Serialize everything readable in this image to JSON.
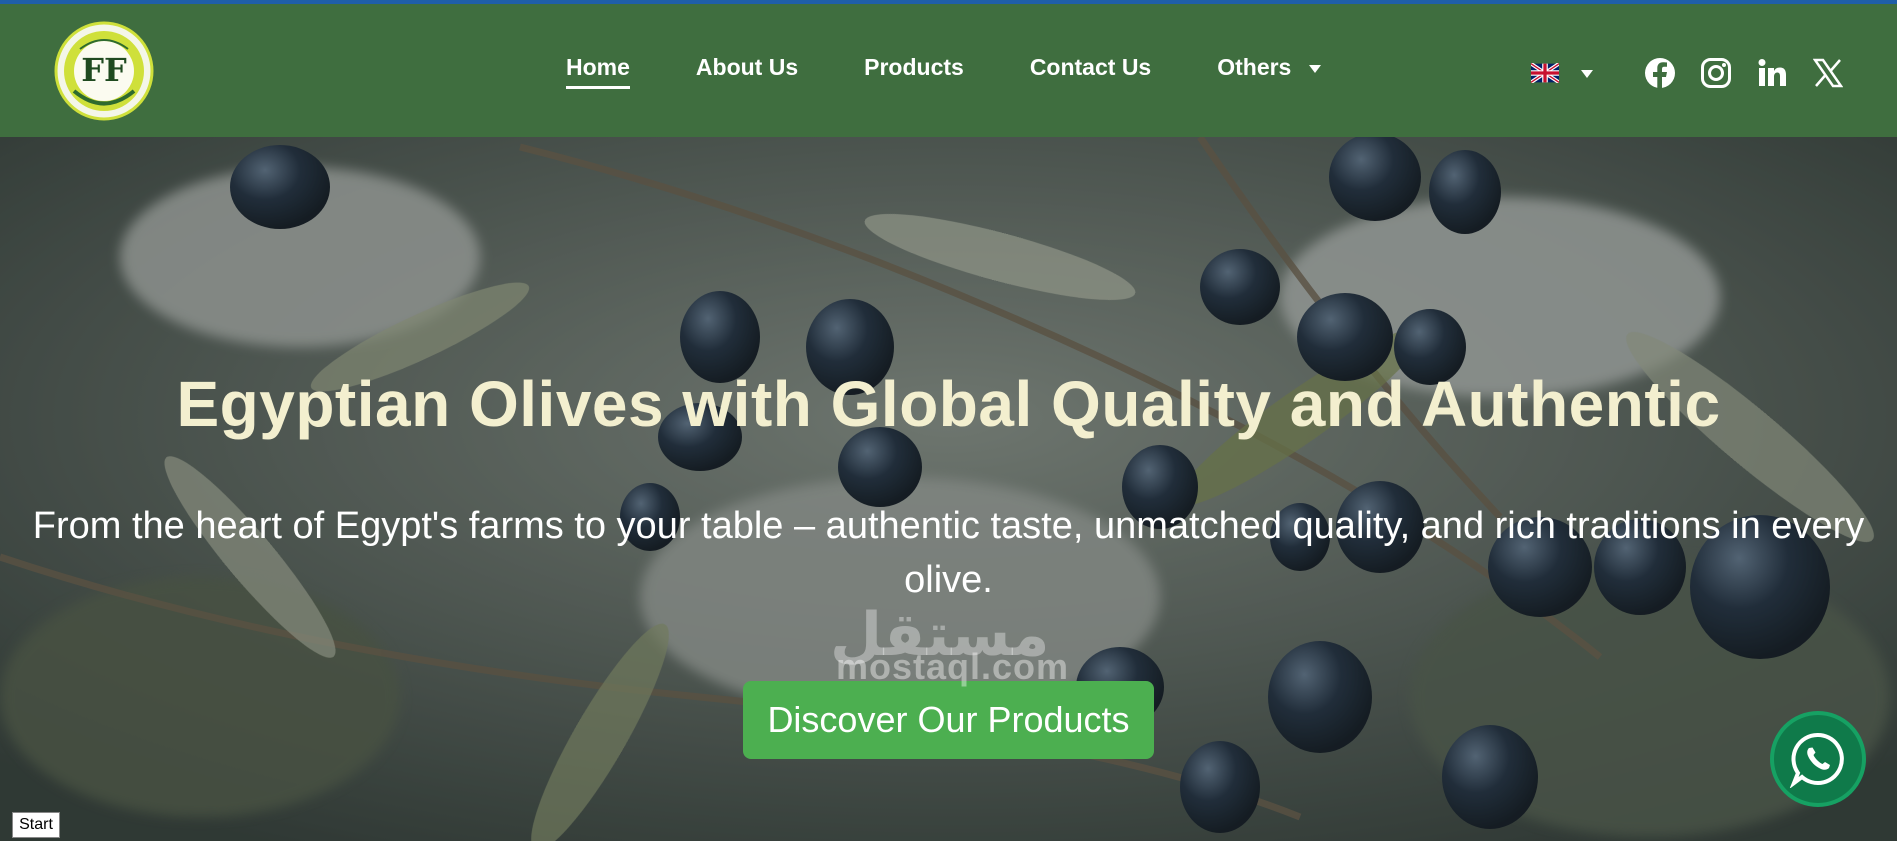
{
  "brand": {
    "logo_text": "FF",
    "logo_ring_text": "Future Food",
    "icon": "future-food-logo"
  },
  "nav": {
    "items": [
      {
        "label": "Home",
        "active": true
      },
      {
        "label": "About Us",
        "active": false
      },
      {
        "label": "Products",
        "active": false
      },
      {
        "label": "Contact Us",
        "active": false
      },
      {
        "label": "Others",
        "active": false
      }
    ]
  },
  "language": {
    "icon": "uk-flag-icon"
  },
  "social": [
    "facebook-icon",
    "instagram-icon",
    "linkedin-icon",
    "x-icon"
  ],
  "hero": {
    "title": "Egyptian Olives with Global Quality and Authentic",
    "subtitle": "From the heart of Egypt's farms to your table – authentic taste, unmatched quality, and rich traditions in every olive.",
    "cta_label": "Discover Our Products"
  },
  "watermark": {
    "arabic": "مستقل",
    "latin": "mostaql.com"
  },
  "floating": {
    "icon": "whatsapp-icon"
  },
  "taskbar": {
    "start_label": "Start"
  },
  "colors": {
    "header_bg": "#3f6e3f",
    "cta_bg": "#4caf50",
    "title_color": "#f3efcf",
    "whatsapp_bg": "#0f7a4a"
  }
}
